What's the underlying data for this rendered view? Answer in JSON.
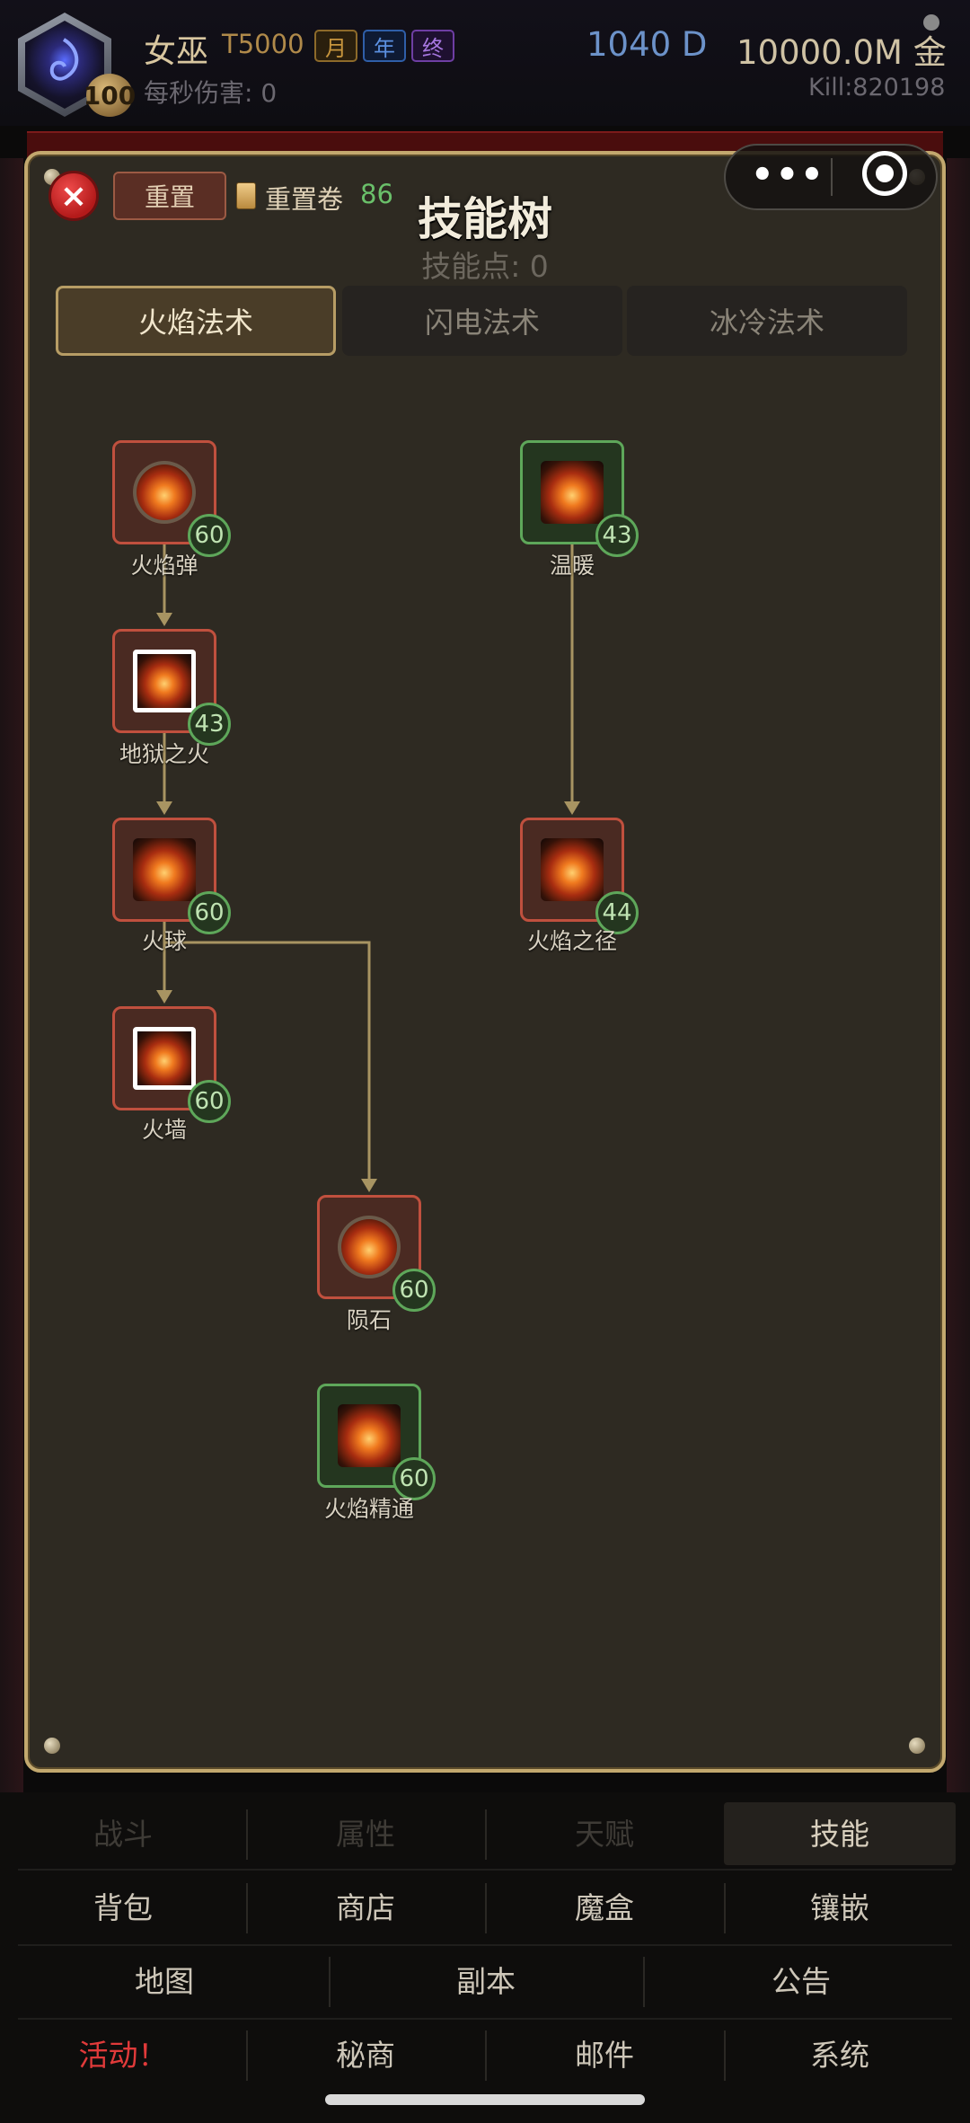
{
  "header": {
    "level": "100",
    "name": "女巫",
    "tier": "T5000",
    "tags": [
      "月",
      "年",
      "终"
    ],
    "dps": "每秒伤害: 0",
    "diamonds": "1040 D",
    "gold": "10000.0M 金",
    "kills": "Kill:820198"
  },
  "panel": {
    "close_icon": "×",
    "reset_label": "重置",
    "scroll_label": "重置卷",
    "scroll_count": "86",
    "title": "技能树",
    "skill_points": "技能点: 0",
    "tabs": [
      "火焰法术",
      "闪电法术",
      "冰冷法术"
    ],
    "active_tab": "火焰法术"
  },
  "capsule": {
    "menu_dots": "•••"
  },
  "skills": [
    {
      "id": "fire-bolt",
      "name": "火焰弹",
      "level": "60",
      "color": "red"
    },
    {
      "id": "hellfire",
      "name": "地狱之火",
      "level": "43",
      "color": "red"
    },
    {
      "id": "fireball",
      "name": "火球",
      "level": "60",
      "color": "red"
    },
    {
      "id": "fire-wall",
      "name": "火墙",
      "level": "60",
      "color": "red"
    },
    {
      "id": "meteor",
      "name": "陨石",
      "level": "60",
      "color": "red"
    },
    {
      "id": "fire-mastery",
      "name": "火焰精通",
      "level": "60",
      "color": "green"
    },
    {
      "id": "warmth",
      "name": "温暖",
      "level": "43",
      "color": "green"
    },
    {
      "id": "blaze",
      "name": "火焰之径",
      "level": "44",
      "color": "red"
    }
  ],
  "nav": {
    "row1": [
      "战斗",
      "属性",
      "天赋",
      "技能"
    ],
    "row2": [
      "背包",
      "商店",
      "魔盒",
      "镶嵌"
    ],
    "row3": [
      "地图",
      "副本",
      "公告"
    ],
    "row4": [
      "活动！",
      "秘商",
      "邮件",
      "系统"
    ],
    "active": "技能"
  },
  "colors": {
    "panel_border": "#c3a86e",
    "node_red": "#c0503e",
    "node_green": "#5ea75a",
    "accent_activity": "#e03a3a"
  }
}
